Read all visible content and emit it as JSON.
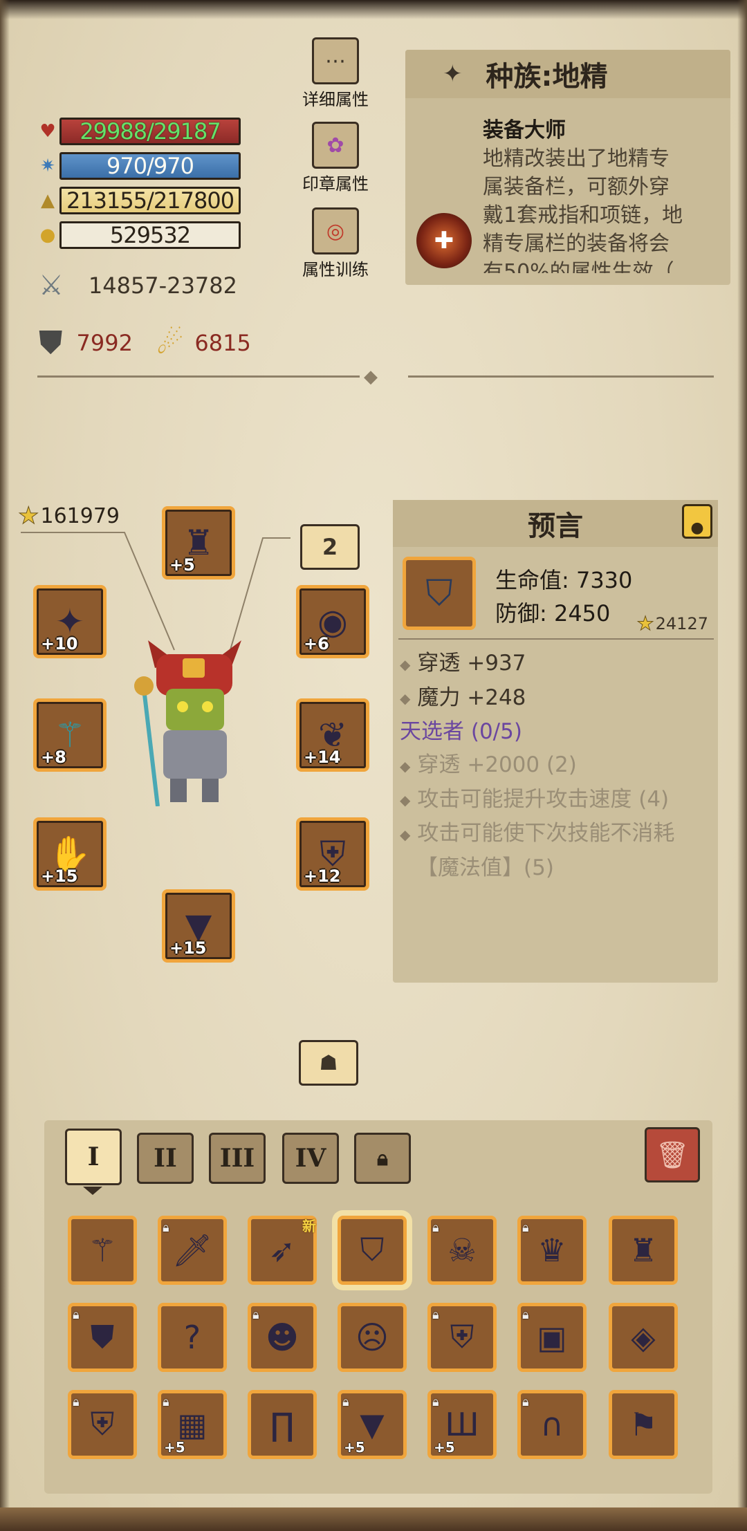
{
  "stats": {
    "hp": "29988/29187",
    "mp": "970/970",
    "xp": "213155/217800",
    "gold": "529532",
    "attack": "14857-23782",
    "armor": "7992",
    "magic_resist": "6815"
  },
  "side_buttons": {
    "details": "详细属性",
    "seal": "印章属性",
    "training": "属性训练"
  },
  "race": {
    "title": "种族:地精",
    "skill_name": "装备大师",
    "skill_desc_lines": [
      "地精改装出了地精专",
      "属装备栏，可额外穿",
      "戴1套戒指和项链，地",
      "精专属栏的装备将会",
      "有50%的属性生效（"
    ]
  },
  "equipment": {
    "score": "161979",
    "count_badge": "2",
    "slots": [
      {
        "name": "helmet",
        "level": "+5",
        "icon": "horned-helmet-icon"
      },
      {
        "name": "necklace",
        "level": "+6",
        "icon": "amulet-icon"
      },
      {
        "name": "weapon-left",
        "level": "+10",
        "icon": "claw-weapon-icon"
      },
      {
        "name": "shoulder",
        "level": "+14",
        "icon": "ram-horn-shoulder-icon"
      },
      {
        "name": "staff",
        "level": "+8",
        "icon": "staff-icon"
      },
      {
        "name": "armor",
        "level": "+12",
        "icon": "chest-armor-icon"
      },
      {
        "name": "gloves",
        "level": "+15",
        "icon": "gauntlet-icon"
      },
      {
        "name": "legs",
        "level": "+15",
        "icon": "leg-armor-icon"
      }
    ]
  },
  "item_info": {
    "title": "预言",
    "hp_line": "生命值: 7330",
    "def_line": "防御: 2450",
    "score": "24127",
    "line1": "穿透 +937",
    "line2": "魔力 +248",
    "set_name": "天选者 (0/5)",
    "set1": "穿透 +2000 (2)",
    "set2": "攻击可能提升攻击速度 (4)",
    "set3a": "攻击可能使下次技能不消耗",
    "set3b": "【魔法值】(5)"
  },
  "tabs": [
    "I",
    "II",
    "III",
    "IV"
  ],
  "inventory": {
    "rows": [
      [
        {
          "icon": "staff-icon",
          "locked": false,
          "level": ""
        },
        {
          "icon": "sword-icon",
          "locked": true,
          "level": ""
        },
        {
          "icon": "feather-dagger-icon",
          "locked": false,
          "level": "",
          "new": "新"
        },
        {
          "icon": "helmet-icon",
          "locked": false,
          "level": "",
          "selected": true
        },
        {
          "icon": "bull-skull-helmet-icon",
          "locked": true,
          "level": ""
        },
        {
          "icon": "goblin-hat-icon",
          "locked": true,
          "level": ""
        },
        {
          "icon": "horned-helmet-icon",
          "locked": false,
          "level": ""
        }
      ],
      [
        {
          "icon": "knight-helmet-icon",
          "locked": true,
          "level": ""
        },
        {
          "icon": "mystery-helmet-icon",
          "locked": false,
          "level": ""
        },
        {
          "icon": "fur-mask-icon",
          "locked": true,
          "level": ""
        },
        {
          "icon": "demon-mask-icon",
          "locked": false,
          "level": ""
        },
        {
          "icon": "chest-plate-icon",
          "locked": true,
          "level": ""
        },
        {
          "icon": "leather-vest-icon",
          "locked": true,
          "level": ""
        },
        {
          "icon": "pauldron-icon",
          "locked": false,
          "level": ""
        }
      ],
      [
        {
          "icon": "steel-armor-icon",
          "locked": true,
          "level": ""
        },
        {
          "icon": "shadow-armor-icon",
          "locked": true,
          "level": "+5"
        },
        {
          "icon": "red-pants-icon",
          "locked": false,
          "level": ""
        },
        {
          "icon": "dark-robe-icon",
          "locked": true,
          "level": "+5"
        },
        {
          "icon": "cloth-leggings-icon",
          "locked": true,
          "level": "+5"
        },
        {
          "icon": "iron-greaves-icon",
          "locked": true,
          "level": ""
        },
        {
          "icon": "noble-coat-icon",
          "locked": false,
          "level": ""
        }
      ]
    ]
  },
  "colors": {
    "hp_bar": "#a0332f",
    "mp_bar": "#4c80b8",
    "xp_bar": "#edd690",
    "slot_border": "#f0a53c",
    "set_name": "#6a46a0",
    "defense_text": "#8a2a22"
  }
}
